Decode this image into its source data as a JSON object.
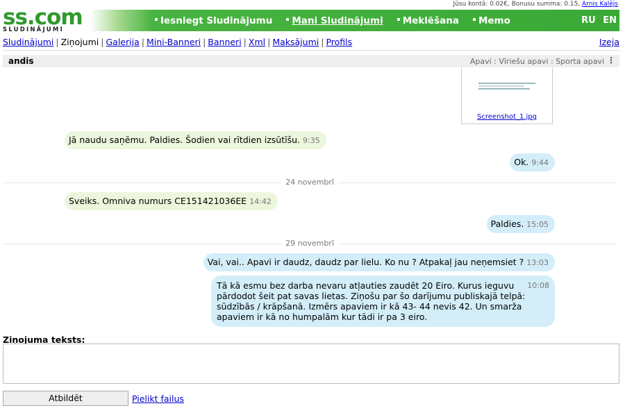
{
  "topbar": {
    "balance_text": "Jūsu kontā: 0.02€, Bonusu summa: 0.15,",
    "user_name": "Arnis Kalējs"
  },
  "logo": {
    "main": "ss.com",
    "sub": "SLUDINĀJUMI"
  },
  "nav": {
    "items": [
      "Iesniegt Sludinājumu",
      "Mani Sludinājumi",
      "Meklēšana",
      "Memo"
    ],
    "active_index": 1
  },
  "lang": [
    "RU",
    "EN"
  ],
  "subnav": {
    "items": [
      "Sludinājumi",
      "Ziņojumi",
      "Galerija",
      "Mini-Banneri",
      "Banneri",
      "Xml",
      "Maksājumi",
      "Profils"
    ],
    "current": "Ziņojumi",
    "exit": "Izeja"
  },
  "conversation": {
    "partner": "andis",
    "category": "Apavi : Vīriešu apavi : Sporta apavi",
    "attachment_name": "Screenshot_1.jpg"
  },
  "messages": [
    {
      "dir": "in",
      "text": "Jā naudu saņēmu. Paldies. Šodien vai rītdien izsūtīšu.",
      "time": "9:35"
    },
    {
      "dir": "out",
      "text": "Ok.",
      "time": "9:44"
    },
    {
      "dir": "sep",
      "text": "24 novembrī"
    },
    {
      "dir": "in",
      "text": "Sveiks. Omniva numurs CE151421036EE",
      "time": "14:42"
    },
    {
      "dir": "out",
      "text": "Paldies.",
      "time": "15:05"
    },
    {
      "dir": "sep",
      "text": "29 novembrī"
    },
    {
      "dir": "out",
      "text": "Vai, vai.. Apavi ir daudz, daudz par lielu. Ko nu ? Atpakaļ jau neņemsiet ?",
      "time": "13:03"
    },
    {
      "dir": "out",
      "text": "Tā kā esmu bez darba nevaru atļauties zaudēt 20 Eiro. Kurus ieguvu pārdodot šeit pat savas lietas. Ziņošu par šo darījumu publiskajā telpā: sūdzībās / krāpšanā. Izmērs apaviem ir kā 43- 44 nevis 42. Un smarža apaviem ir kā no humpalām kur tādi ir pa 3 eiro.",
      "time": "10:08"
    }
  ],
  "reply": {
    "label": "Ziņojuma teksts:",
    "value": "",
    "send_label": "Atbildēt",
    "attach_label": "Pielikt failus"
  },
  "colors": {
    "brand_green": "#3aa936",
    "incoming_bubble": "#ecf6dc",
    "outgoing_bubble": "#d3eef9",
    "link": "#0000cc"
  }
}
